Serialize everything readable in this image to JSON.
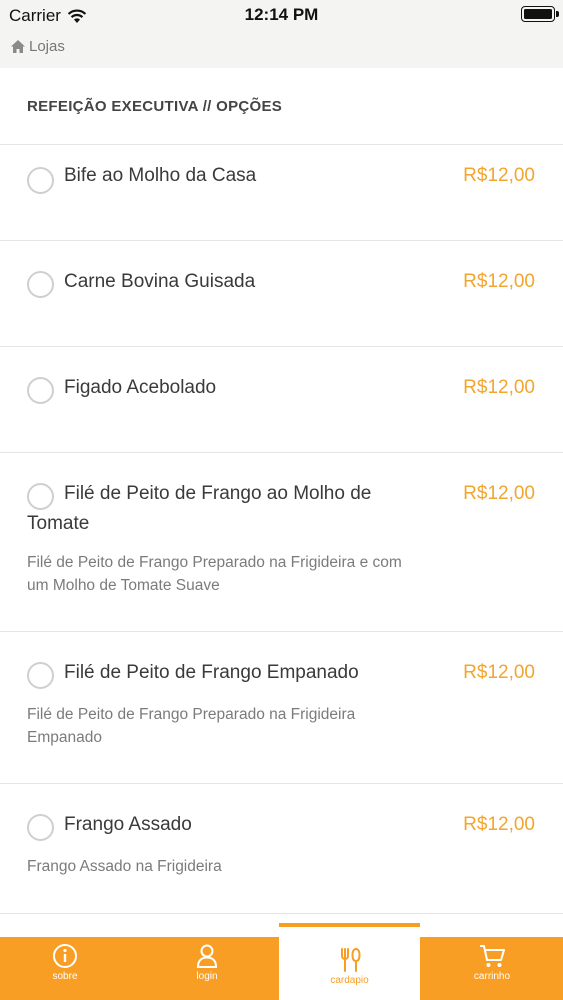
{
  "status_bar": {
    "carrier": "Carrier",
    "time": "12:14 PM"
  },
  "nav": {
    "back_label": "Lojas",
    "back_icon": "home-icon"
  },
  "section": {
    "title": "REFEIÇÃO EXECUTIVA // OPÇÕES"
  },
  "items": [
    {
      "name": "Bife ao Molho da Casa",
      "price": "R$12,00",
      "description": ""
    },
    {
      "name": "Carne Bovina Guisada",
      "price": "R$12,00",
      "description": ""
    },
    {
      "name": "Figado Acebolado",
      "price": "R$12,00",
      "description": ""
    },
    {
      "name": "Filé de Peito de Frango ao Molho de Tomate",
      "price": "R$12,00",
      "description": "Filé de Peito de Frango Preparado na Frigideira e com um Molho de Tomate Suave"
    },
    {
      "name": "Filé de Peito de Frango Empanado",
      "price": "R$12,00",
      "description": "Filé de Peito de Frango Preparado na Frigideira Empanado"
    },
    {
      "name": "Frango Assado",
      "price": "R$12,00",
      "description": "Frango Assado na Frigideira"
    }
  ],
  "tabs": [
    {
      "label": "sobre",
      "icon": "info-icon",
      "active": false
    },
    {
      "label": "login",
      "icon": "user-icon",
      "active": false
    },
    {
      "label": "cardapio",
      "icon": "cutlery-icon",
      "active": true
    },
    {
      "label": "carrinho",
      "icon": "cart-icon",
      "active": false
    }
  ],
  "colors": {
    "accent": "#f99e25",
    "price": "#f2a52f",
    "header_bg": "#f4f4f2"
  }
}
